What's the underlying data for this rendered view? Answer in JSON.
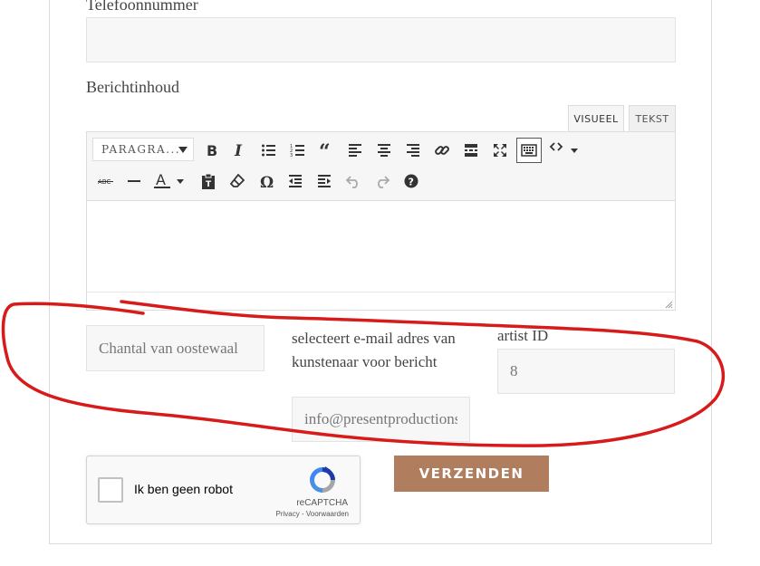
{
  "form": {
    "phone_label": "Telefoonnummer",
    "phone_value": "",
    "message_label": "Berichtinhoud",
    "editor": {
      "tabs": [
        "VISUEEL",
        "TEKST"
      ],
      "format_select": "PARAGRA...",
      "toolbar_icons": [
        "bold-icon",
        "italic-icon",
        "bullet-list-icon",
        "numbered-list-icon",
        "blockquote-icon",
        "align-left-icon",
        "align-center-icon",
        "align-right-icon",
        "link-icon",
        "read-more-icon",
        "fullscreen-icon",
        "keyboard-icon",
        "code-icon",
        "strikethrough-icon",
        "horizontal-line-icon",
        "text-color-icon",
        "paste-text-icon",
        "clear-format-icon",
        "special-char-icon",
        "outdent-icon",
        "indent-icon",
        "undo-icon",
        "redo-icon",
        "help-icon"
      ]
    },
    "artist_name_value": "Chantal van oostewaal",
    "email_select_label": "selecteert e-mail adres van kunstenaar voor bericht",
    "email_value": "info@presentproductions",
    "artist_id_label": "artist ID",
    "artist_id_value": "8",
    "captcha": {
      "label": "Ik ben geen robot",
      "brand": "reCAPTCHA",
      "links": "Privacy - Voorwaarden"
    },
    "submit_label": "VERZENDEN"
  },
  "colors": {
    "accent": "#b17d5f",
    "annotation": "#d71a1a",
    "field_bg": "#f7f7f7"
  }
}
